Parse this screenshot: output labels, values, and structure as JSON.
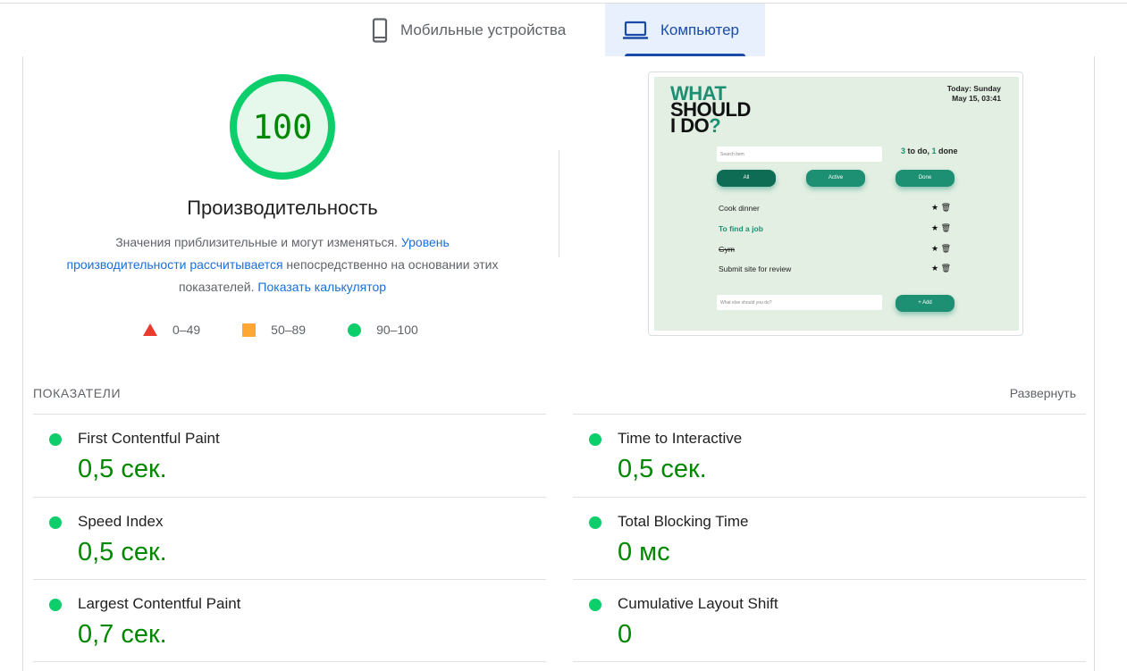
{
  "tabs": {
    "mobile": {
      "label": "Мобильные устройства",
      "icon": "smartphone-icon"
    },
    "desktop": {
      "label": "Компьютер",
      "icon": "laptop-icon",
      "selected": true
    }
  },
  "category": {
    "score": "100",
    "score_fraction": 1.0,
    "title": "Производительность",
    "description_text": "Значения приблизительные и могут изменяться. ",
    "description_link": "Уровень производительности рассчитывается",
    "description_middle": " непосредственно на основании этих показателей. ",
    "calculator_link": "Показать калькулятор"
  },
  "legend": [
    {
      "shape": "triangle",
      "range": "0–49",
      "color": "#eb3b2f"
    },
    {
      "shape": "square",
      "range": "50–89",
      "color": "#ffa733"
    },
    {
      "shape": "circle",
      "range": "90–100",
      "color": "#0cce6b"
    }
  ],
  "screenshot": {
    "logo_line1": "WHAT",
    "logo_line2": "SHOULD",
    "logo_line3": "I DO",
    "logo_q": "?",
    "date_line1": "Today: Sunday",
    "date_line2": "May 15, 03:41",
    "search_placeholder": "Search item",
    "counts_todo": "3",
    "counts_todo_label": " to do, ",
    "counts_done": "1",
    "counts_done_label": " done",
    "filters": [
      "All",
      "Active",
      "Done"
    ],
    "items": [
      {
        "text": "Cook dinner",
        "style": "normal"
      },
      {
        "text": "To find a job",
        "style": "important"
      },
      {
        "text": "Gym",
        "style": "done"
      },
      {
        "text": "Submit site for review",
        "style": "normal"
      }
    ],
    "add_placeholder": "What else should you do?",
    "add_button": "+ Add"
  },
  "metrics": {
    "heading": "ПОКАЗАТЕЛИ",
    "expand": "Развернуть",
    "items": [
      {
        "name": "First Contentful Paint",
        "value": "0,5 сек.",
        "status": "good"
      },
      {
        "name": "Time to Interactive",
        "value": "0,5 сек.",
        "status": "good"
      },
      {
        "name": "Speed Index",
        "value": "0,5 сек.",
        "status": "good"
      },
      {
        "name": "Total Blocking Time",
        "value": "0 мс",
        "status": "good"
      },
      {
        "name": "Largest Contentful Paint",
        "value": "0,7 сек.",
        "status": "good"
      },
      {
        "name": "Cumulative Layout Shift",
        "value": "0",
        "status": "good"
      }
    ]
  },
  "colors": {
    "pass": "#0cce6b",
    "pass_text": "#008800",
    "accent": "#1a4ba8",
    "link": "#1a6fd8"
  }
}
